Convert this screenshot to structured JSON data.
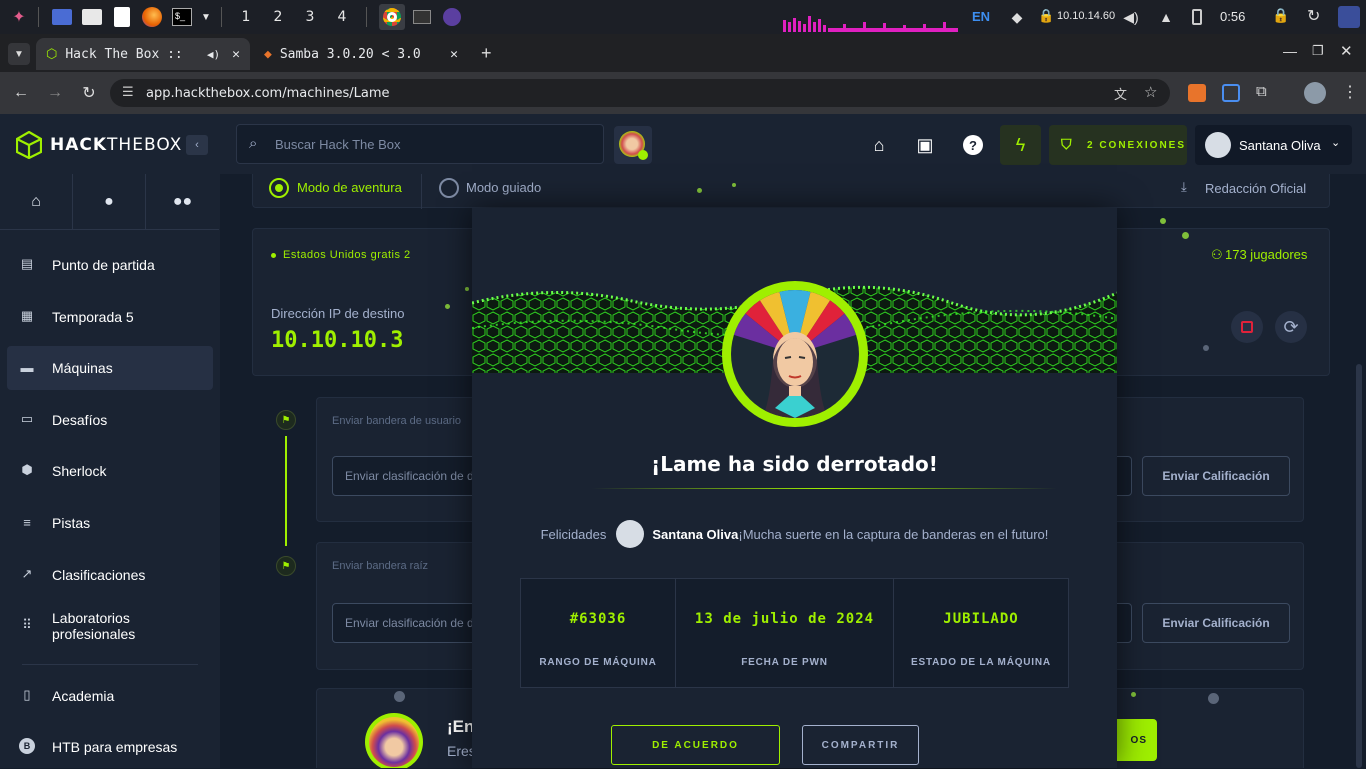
{
  "taskbar": {
    "workspaces": [
      "1",
      "2",
      "3",
      "4"
    ],
    "keyboard": "EN",
    "ip": "10.10.14.60",
    "clock": "0:56"
  },
  "browser": {
    "tabs": [
      {
        "title": "Hack The Box ::"
      },
      {
        "title": "Samba 3.0.20 < 3.0"
      }
    ],
    "url": "app.hackthebox.com/machines/Lame"
  },
  "header": {
    "logo_prefix": "HACK",
    "logo_suffix": "THEBOX",
    "search_placeholder": "Buscar Hack The Box",
    "connections_label": "2 CONEXIONES",
    "username": "Santana Oliva"
  },
  "sidebar": {
    "items": [
      {
        "label": "Punto de partida",
        "icon": "book-icon"
      },
      {
        "label": "Temporada 5",
        "icon": "calendar-icon"
      },
      {
        "label": "Máquinas",
        "icon": "server-icon"
      },
      {
        "label": "Desafíos",
        "icon": "lock-icon"
      },
      {
        "label": "Sherlock",
        "icon": "shield-icon"
      },
      {
        "label": "Pistas",
        "icon": "stack-icon"
      },
      {
        "label": "Clasificaciones",
        "icon": "trend-icon"
      },
      {
        "label": "Laboratorios profesionales",
        "icon": "grid-icon"
      },
      {
        "label": "Academia",
        "icon": "academy-icon"
      },
      {
        "label": "HTB para empresas",
        "icon": "business-icon"
      }
    ]
  },
  "main": {
    "mode_adventure": "Modo de aventura",
    "mode_guided": "Modo guiado",
    "official_writeup": "Redacción Oficial",
    "server": "Estados Unidos gratis 2",
    "players": "173 jugadores",
    "target_ip_label": "Dirección IP de destino",
    "target_ip": "10.10.10.3",
    "user_flag_label": "Enviar bandera de usuario",
    "root_flag_label": "Enviar bandera raíz",
    "flag_input_placeholder": "Enviar clasificación de d",
    "submit_button": "Enviar Calificación",
    "bottom_heading": "¡En",
    "bottom_sub": "Eres",
    "bottom_btn": "OS"
  },
  "modal": {
    "title": "¡Lame ha sido derrotado!",
    "congrats": "Felicidades",
    "username": "Santana Oliva",
    "message": "¡Mucha suerte en la captura de banderas en el futuro!",
    "stats": [
      {
        "value": "#63036",
        "label": "RANGO DE MÁQUINA"
      },
      {
        "value": "13 de julio de 2024",
        "label": "FECHA DE PWN"
      },
      {
        "value": "JUBILADO",
        "label": "ESTADO DE LA MÁQUINA"
      }
    ],
    "ok_button": "DE ACUERDO",
    "share_button": "COMPARTIR"
  },
  "colors": {
    "accent": "#9fef00",
    "bg": "#141d2b",
    "panel": "#1a2332"
  }
}
